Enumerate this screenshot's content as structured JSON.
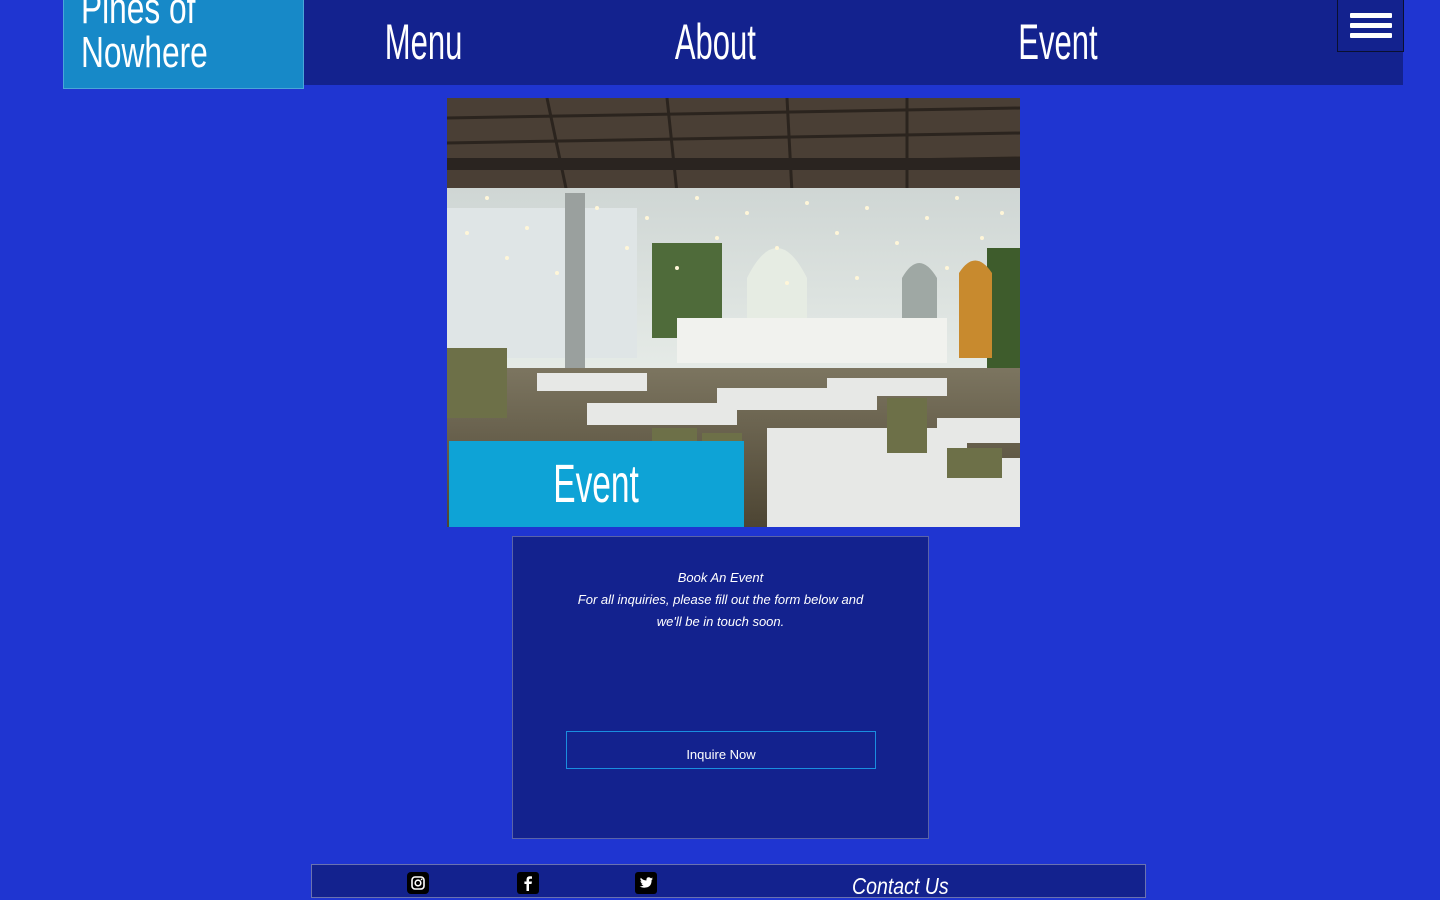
{
  "brand": {
    "name_line1": "Pines of",
    "name_line2": "Nowhere"
  },
  "nav": {
    "items": [
      {
        "label": "Menu"
      },
      {
        "label": "About"
      },
      {
        "label": "Event"
      }
    ],
    "menu_icon": "hamburger-menu-icon"
  },
  "hero": {
    "image_description": "restaurant-interior-photo",
    "label": "Event"
  },
  "booking": {
    "title": "Book An Event",
    "text": "For all inquiries, please fill out the form below and we'll be in touch soon.",
    "button_label": "Inquire Now"
  },
  "footer": {
    "social": [
      {
        "icon": "instagram-icon"
      },
      {
        "icon": "facebook-icon"
      },
      {
        "icon": "twitter-icon"
      }
    ],
    "contact_label": "Contact Us"
  },
  "colors": {
    "page_background": "#1f35d1",
    "navbar_background": "#13228e",
    "logo_background": "#1789c8",
    "accent": "#0ea3d6",
    "button_border": "#1a8ee0"
  }
}
